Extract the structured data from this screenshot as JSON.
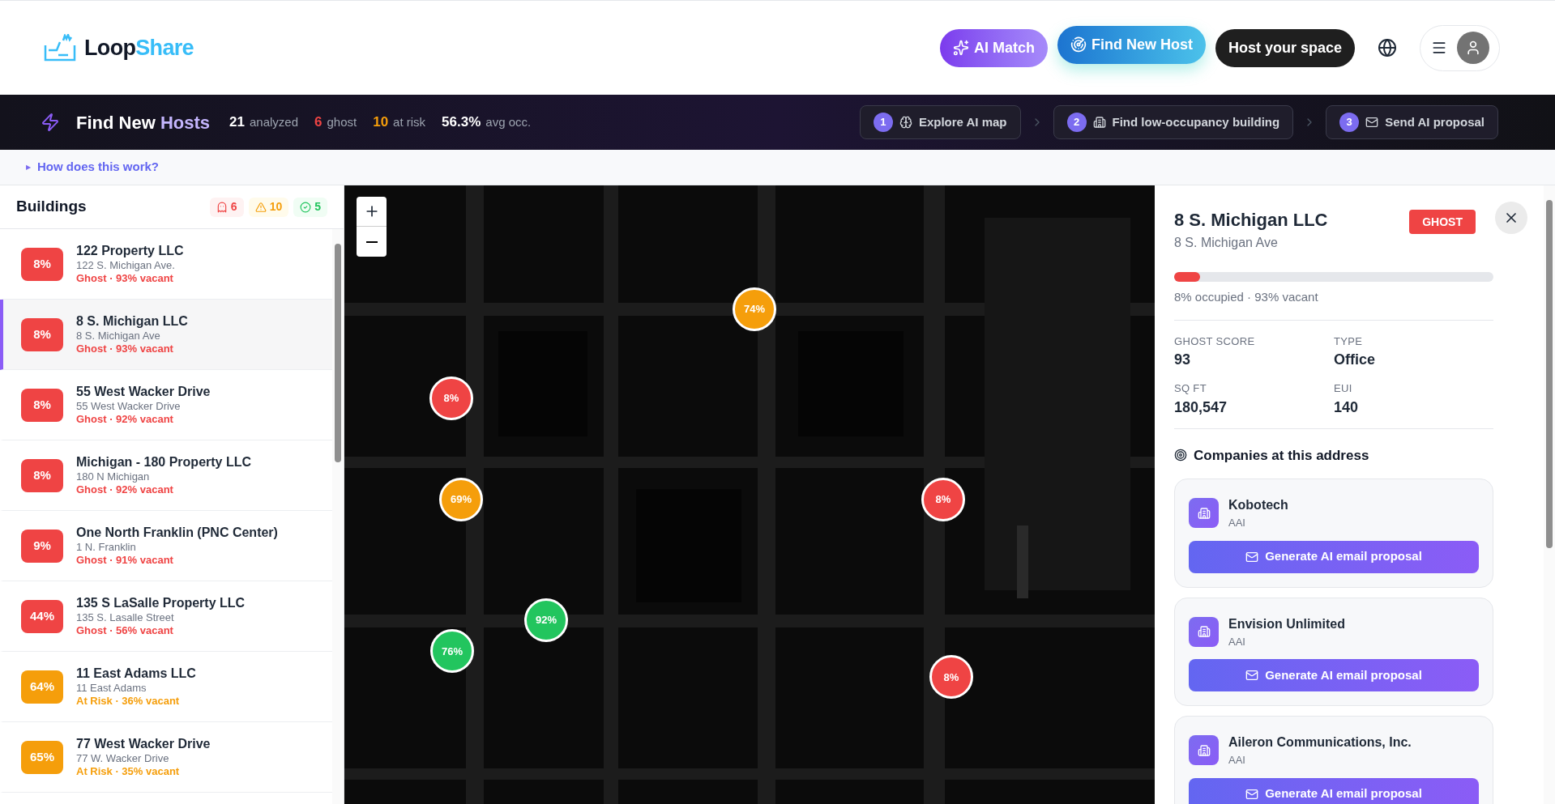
{
  "brand": {
    "first": "Loop",
    "second": "Share"
  },
  "nav": {
    "ai_match": "AI Match",
    "find_host": "Find New Host",
    "host_space": "Host your space"
  },
  "hero": {
    "title_first": "Find New",
    "title_second": "Hosts",
    "stats": [
      {
        "count": "21",
        "caption": "analyzed",
        "kind": "neutral"
      },
      {
        "count": "6",
        "caption": "ghost",
        "kind": "ghost"
      },
      {
        "count": "10",
        "caption": "at risk",
        "kind": "risk"
      },
      {
        "count": "56.3%",
        "caption": "avg occ.",
        "kind": "neutral"
      }
    ],
    "steps": [
      {
        "number": "1",
        "label": "Explore AI map",
        "kind": "brain"
      },
      {
        "number": "2",
        "label": "Find low-occupancy building",
        "kind": "building"
      },
      {
        "number": "3",
        "label": "Send AI proposal",
        "kind": "mail"
      }
    ]
  },
  "help_marker": "▶",
  "help_link": "How does this work?",
  "buildings": {
    "title": "Buildings",
    "counts": [
      {
        "kind": "ghost",
        "value": "6"
      },
      {
        "kind": "risk",
        "value": "10"
      },
      {
        "kind": "ok",
        "value": "5"
      }
    ],
    "items": [
      {
        "percent": "8%",
        "name": "122 Property LLC",
        "address": "122 S. Michigan Ave.",
        "status": "Ghost · 93% vacant",
        "kind": "ghost",
        "selected": false
      },
      {
        "percent": "8%",
        "name": "8 S. Michigan LLC",
        "address": "8 S. Michigan Ave",
        "status": "Ghost · 93% vacant",
        "kind": "ghost",
        "selected": true
      },
      {
        "percent": "8%",
        "name": "55 West Wacker Drive",
        "address": "55 West Wacker Drive",
        "status": "Ghost · 92% vacant",
        "kind": "ghost",
        "selected": false
      },
      {
        "percent": "8%",
        "name": "Michigan - 180 Property LLC",
        "address": "180 N Michigan",
        "status": "Ghost · 92% vacant",
        "kind": "ghost",
        "selected": false
      },
      {
        "percent": "9%",
        "name": "One North Franklin (PNC Center)",
        "address": "1 N. Franklin",
        "status": "Ghost · 91% vacant",
        "kind": "ghost",
        "selected": false
      },
      {
        "percent": "44%",
        "name": "135 S LaSalle Property LLC",
        "address": "135 S. Lasalle Street",
        "status": "Ghost · 56% vacant",
        "kind": "ghost",
        "selected": false
      },
      {
        "percent": "64%",
        "name": "11 East Adams LLC",
        "address": "11 East Adams",
        "status": "At Risk · 36% vacant",
        "kind": "risk",
        "selected": false
      },
      {
        "percent": "65%",
        "name": "77 West Wacker Drive",
        "address": "77 W. Wacker Drive",
        "status": "At Risk · 35% vacant",
        "kind": "risk",
        "selected": false
      }
    ]
  },
  "map": {
    "markers": [
      {
        "label": "74%",
        "color": "#f59e0b"
      },
      {
        "label": "8%",
        "color": "#ef4444"
      },
      {
        "label": "69%",
        "color": "#f59e0b"
      },
      {
        "label": "8%",
        "color": "#ef4444"
      },
      {
        "label": "92%",
        "color": "#22c55e"
      },
      {
        "label": "76%",
        "color": "#22c55e"
      },
      {
        "label": "8%",
        "color": "#ef4444"
      }
    ]
  },
  "detail": {
    "name": "8 S. Michigan LLC",
    "address": "8 S. Michigan Ave",
    "badge": "GHOST",
    "level": 0.08,
    "occupancy": "8% occupied · 93% vacant",
    "stats": [
      {
        "label": "GHOST SCORE",
        "value": "93"
      },
      {
        "label": "TYPE",
        "value": "Office"
      },
      {
        "label": "SQ FT",
        "value": "180,547"
      },
      {
        "label": "EUI",
        "value": "140"
      }
    ],
    "companies_title": "Companies at this address",
    "companies": [
      {
        "name": "Kobotech",
        "subtitle": "AAI",
        "action": "Generate AI email proposal"
      },
      {
        "name": "Envision Unlimited",
        "subtitle": "AAI",
        "action": "Generate AI email proposal"
      },
      {
        "name": "Aileron Communications, Inc.",
        "subtitle": "AAI",
        "action": "Generate AI email proposal"
      }
    ]
  }
}
